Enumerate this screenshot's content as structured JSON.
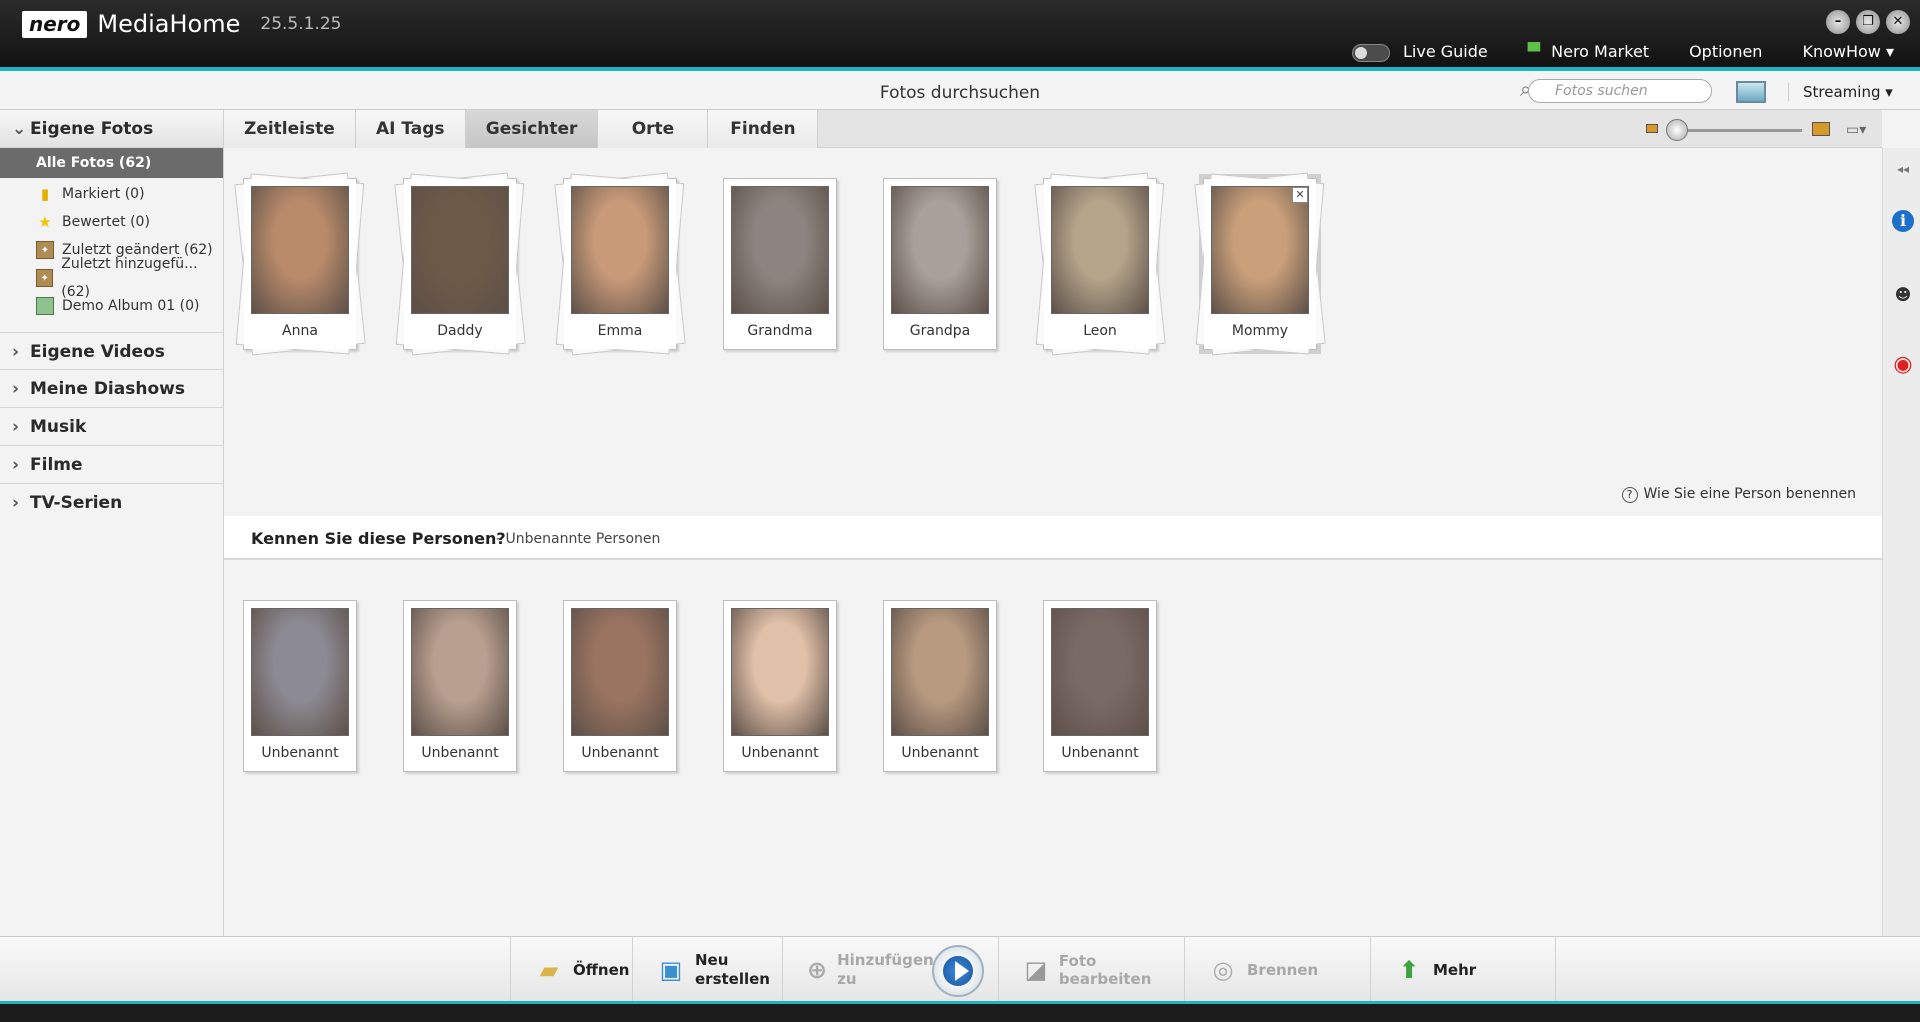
{
  "window": {
    "logo": "nero",
    "app_name": "MediaHome",
    "version": "25.5.1.25",
    "controls": [
      "–",
      "❐",
      "✕"
    ]
  },
  "topmenu": {
    "live_guide": "Live Guide",
    "market": "Nero Market",
    "options": "Optionen",
    "knowhow": "KnowHow"
  },
  "subbar": {
    "title": "Fotos durchsuchen",
    "search_placeholder": "Fotos suchen",
    "streaming": "Streaming"
  },
  "sidebar": {
    "photos": {
      "label": "Eigene Fotos",
      "items": [
        {
          "label": "Alle Fotos (62)",
          "icon": "none"
        },
        {
          "label": "Markiert (0)",
          "icon": "flag-icon"
        },
        {
          "label": "Bewertet (0)",
          "icon": "star-icon"
        },
        {
          "label": "Zuletzt geändert (62)",
          "icon": "album-icon"
        },
        {
          "label": "Zuletzt hinzugefü... (62)",
          "icon": "album-icon"
        },
        {
          "label": "Demo Album 01 (0)",
          "icon": "demo-album-icon"
        }
      ]
    },
    "sections": [
      "Eigene Videos",
      "Meine Diashows",
      "Musik",
      "Filme",
      "TV-Serien"
    ]
  },
  "tabs": [
    {
      "label": "Zeitleiste"
    },
    {
      "label": "AI Tags"
    },
    {
      "label": "Gesichter",
      "active": true
    },
    {
      "label": "Orte"
    },
    {
      "label": "Finden"
    }
  ],
  "faces": {
    "named": [
      "Anna",
      "Daddy",
      "Emma",
      "Grandma",
      "Grandpa",
      "Leon",
      "Mommy"
    ],
    "selected": "Mommy",
    "photo_colors": [
      "#b88a6a",
      "#6e5a48",
      "#c89a78",
      "#8c8480",
      "#a8a09a",
      "#b4a48a",
      "#caa07a"
    ],
    "help_text": "Wie Sie eine Person benennen",
    "unknown_heading": "Kennen Sie diese Personen?",
    "unknown_sub": "- Unbenannte Personen",
    "unknown": [
      "Unbenannt",
      "Unbenannt",
      "Unbenannt",
      "Unbenannt",
      "Unbenannt",
      "Unbenannt"
    ],
    "unknown_colors": [
      "#8c8a92",
      "#b8a090",
      "#9a7460",
      "#e0c0a8",
      "#b89a80",
      "#7a6a66"
    ]
  },
  "bottombar": {
    "open": "Öffnen",
    "new_line1": "Neu",
    "new_line2": "erstellen",
    "add_line1": "Hinzufügen",
    "add_line2": "zu",
    "edit": "Foto bearbeiten",
    "burn": "Brennen",
    "more": "Mehr"
  },
  "colors": {
    "accent": "#21b3c4",
    "titlebar": "#1a1a1a"
  }
}
